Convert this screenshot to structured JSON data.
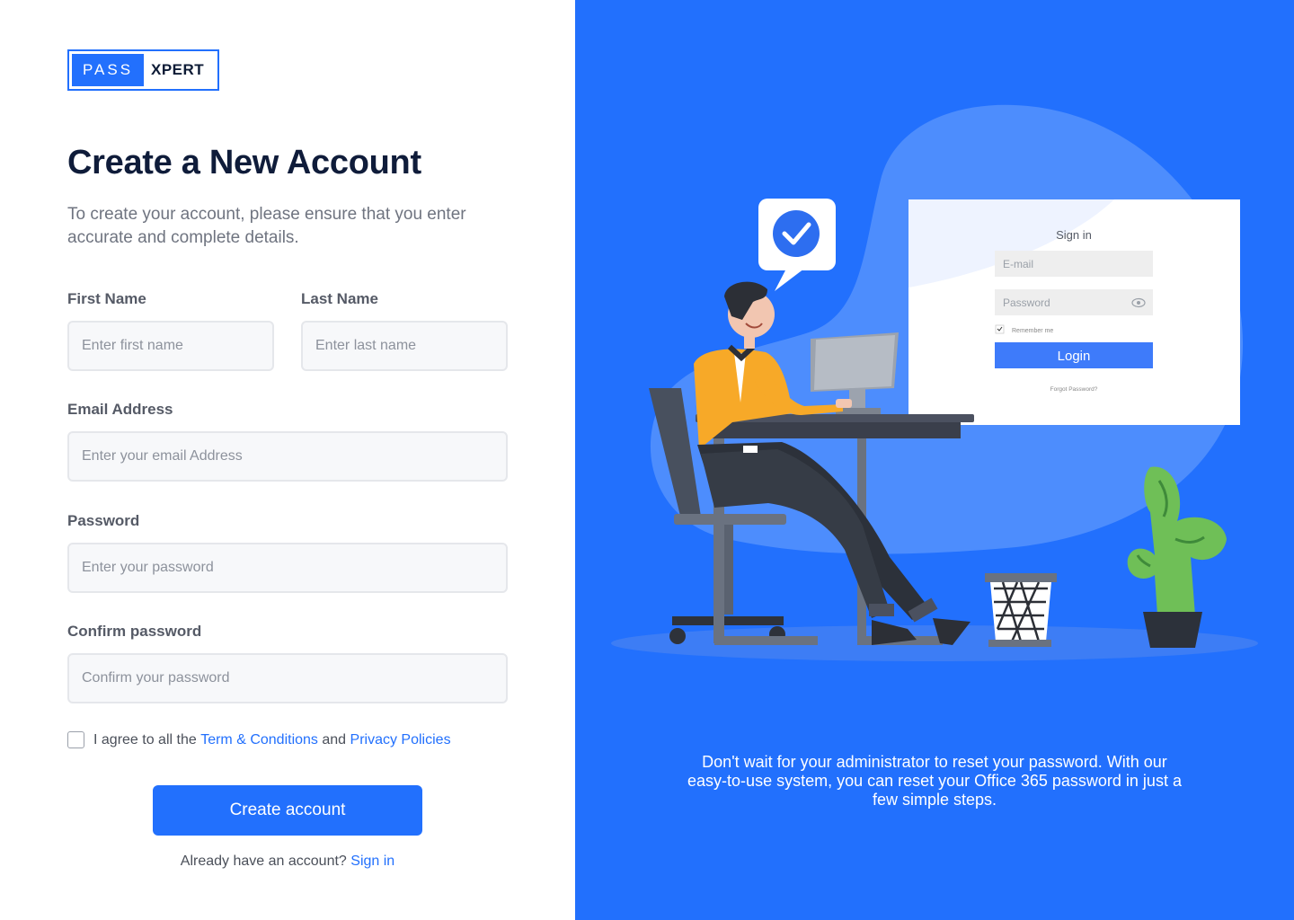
{
  "logo": {
    "part1": "PASS",
    "part2": "XPERT"
  },
  "heading": "Create a New Account",
  "subheading": "To create your account, please ensure that you enter accurate and complete details.",
  "form": {
    "first_name": {
      "label": "First Name",
      "placeholder": "Enter first name"
    },
    "last_name": {
      "label": "Last Name",
      "placeholder": "Enter last name"
    },
    "email": {
      "label": "Email Address",
      "placeholder": "Enter your email Address"
    },
    "password": {
      "label": "Password",
      "placeholder": "Enter your password"
    },
    "confirm_password": {
      "label": "Confirm password",
      "placeholder": "Confirm your password"
    }
  },
  "agreement": {
    "prefix": "I agree to all the",
    "terms": "Term & Conditions",
    "and": "and",
    "privacy": "Privacy Policies"
  },
  "create_button": "Create account",
  "signin_prompt": {
    "text": "Already have an account?",
    "link": "Sign in"
  },
  "illustration": {
    "card_title": "Sign in",
    "email_placeholder": "E-mail",
    "password_placeholder": "Password",
    "remember": "Remember me",
    "login_button": "Login",
    "forgot": "Forgot Password?"
  },
  "promo_text": "Don't wait for your administrator to reset your password. With our easy-to-use system, you can reset your Office 365 password in just a few simple steps.",
  "colors": {
    "primary": "#2270fd",
    "heading": "#0f1c3a",
    "text": "#6f7480"
  }
}
